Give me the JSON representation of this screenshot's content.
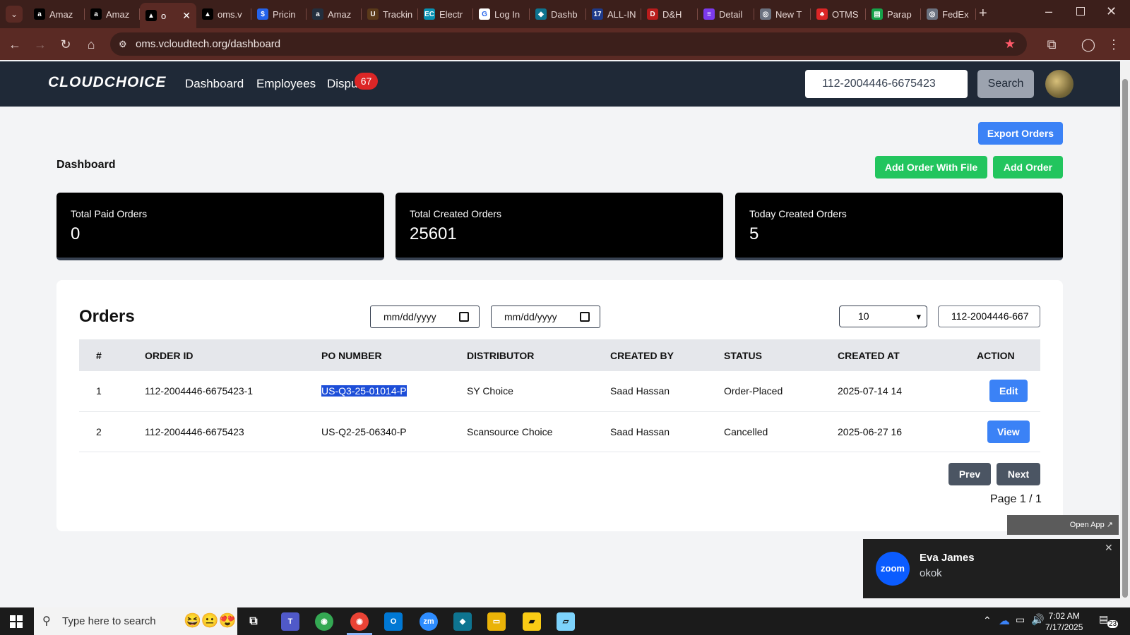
{
  "browser": {
    "tabs": [
      {
        "title": "Amaz",
        "icon": "a",
        "color": "#000000"
      },
      {
        "title": "Amaz",
        "icon": "a",
        "color": "#000000"
      },
      {
        "title": "o",
        "icon": "▲",
        "color": "#000000",
        "active": true
      },
      {
        "title": "oms.v",
        "icon": "▲",
        "color": "#000000"
      },
      {
        "title": "Pricin",
        "icon": "$",
        "color": "#2563eb"
      },
      {
        "title": "Amaz",
        "icon": "a",
        "color": "#232f3e"
      },
      {
        "title": "Trackin",
        "icon": "U",
        "color": "#5a3a1a"
      },
      {
        "title": "Electr",
        "icon": "EC",
        "color": "#0891b2"
      },
      {
        "title": "Log In",
        "icon": "G",
        "color": "#ffffff"
      },
      {
        "title": "Dashb",
        "icon": "◆",
        "color": "#0e7490"
      },
      {
        "title": "ALL-IN",
        "icon": "17",
        "color": "#1e3a8a"
      },
      {
        "title": "D&H",
        "icon": "D",
        "color": "#b91c1c"
      },
      {
        "title": "Detail",
        "icon": "≡",
        "color": "#7c3aed"
      },
      {
        "title": "New T",
        "icon": "◎",
        "color": "#6b7280"
      },
      {
        "title": "OTMS",
        "icon": "♣",
        "color": "#dc2626"
      },
      {
        "title": "Parap",
        "icon": "▤",
        "color": "#16a34a"
      },
      {
        "title": "FedEx",
        "icon": "◎",
        "color": "#6b7280"
      }
    ],
    "url": "oms.vcloudtech.org/dashboard"
  },
  "nav": {
    "logo": "CLOUDCHOICE",
    "links": [
      "Dashboard",
      "Employees",
      "Dispu"
    ],
    "disputes_badge": "67",
    "search_value": "112-2004446-6675423",
    "search_button": "Search"
  },
  "main": {
    "title": "Dashboard",
    "export_button": "Export Orders",
    "add_with_file_button": "Add Order With File",
    "add_order_button": "Add Order",
    "stats": [
      {
        "label": "Total Paid Orders",
        "value": "0"
      },
      {
        "label": "Total Created Orders",
        "value": "25601"
      },
      {
        "label": "Today Created Orders",
        "value": "5"
      }
    ]
  },
  "orders": {
    "title": "Orders",
    "date_from_placeholder": "mm/dd/yyyy",
    "date_to_placeholder": "mm/dd/yyyy",
    "per_page": "10",
    "filter_value": "112-2004446-667",
    "columns": [
      "#",
      "ORDER ID",
      "PO NUMBER",
      "DISTRIBUTOR",
      "CREATED BY",
      "STATUS",
      "CREATED AT",
      "ACTION"
    ],
    "rows": [
      {
        "num": "1",
        "order_id": "112-2004446-6675423-1",
        "po": "US-Q3-25-01014-P",
        "distributor": "SY Choice",
        "created_by": "Saad Hassan",
        "status": "Order-Placed",
        "created_at": "2025-07-14 14",
        "action": "Edit"
      },
      {
        "num": "2",
        "order_id": "112-2004446-6675423",
        "po": "US-Q2-25-06340-P",
        "distributor": "Scansource Choice",
        "created_by": "Saad Hassan",
        "status": "Cancelled",
        "created_at": "2025-06-27 16",
        "action": "View"
      }
    ],
    "prev_button": "Prev",
    "next_button": "Next",
    "page_info": "Page 1 / 1"
  },
  "zoom": {
    "open_app": "Open App ↗",
    "logo": "zoom",
    "sender": "Eva James",
    "message": "okok"
  },
  "taskbar": {
    "search_placeholder": "Type here to search",
    "time": "7:02 AM",
    "date": "7/17/2025",
    "notifications": "23"
  }
}
